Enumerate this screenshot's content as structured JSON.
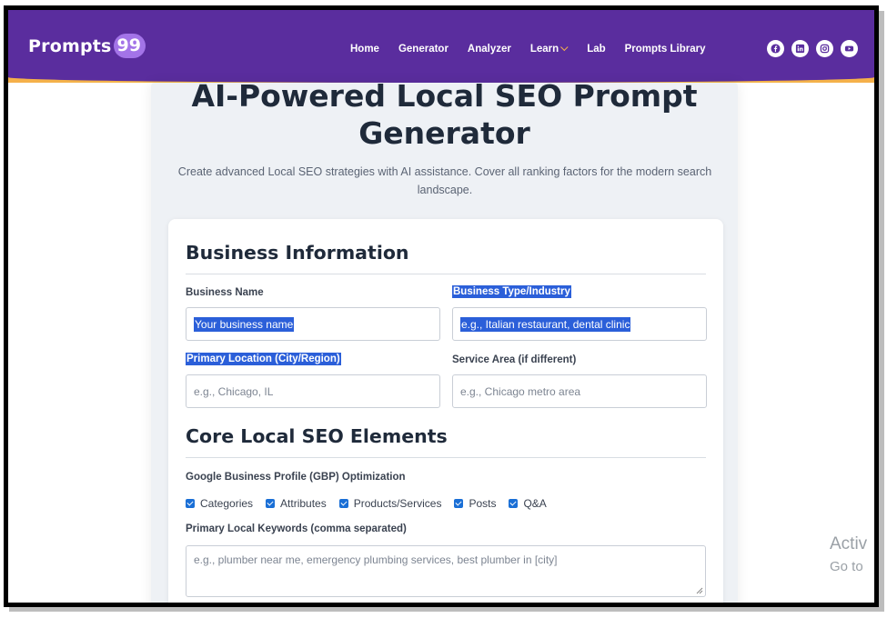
{
  "header": {
    "logo_text": "Prompts",
    "logo_badge": "99",
    "nav": [
      {
        "label": "Home"
      },
      {
        "label": "Generator"
      },
      {
        "label": "Analyzer"
      },
      {
        "label": "Learn"
      },
      {
        "label": "Lab"
      },
      {
        "label": "Prompts Library"
      }
    ],
    "socials": [
      "facebook-icon",
      "linkedin-icon",
      "instagram-icon",
      "youtube-icon"
    ]
  },
  "page": {
    "title_line1": "AI-Powered Local SEO Prompt",
    "title_line2": "Generator",
    "subtitle_line1": "Create advanced Local SEO strategies with AI assistance. Cover all ranking factors for the modern search",
    "subtitle_line2": "landscape."
  },
  "business": {
    "section_title": "Business Information",
    "name_label": "Business Name",
    "name_placeholder": "Your business name",
    "type_label": "Business Type/Industry",
    "type_placeholder": "e.g., Italian restaurant, dental clinic",
    "location_label": "Primary Location (City/Region)",
    "location_placeholder": "e.g., Chicago, IL",
    "service_label": "Service Area (if different)",
    "service_placeholder": "e.g., Chicago metro area"
  },
  "core": {
    "section_title": "Core Local SEO Elements",
    "gbp_label": "Google Business Profile (GBP) Optimization",
    "checks": [
      {
        "label": "Categories"
      },
      {
        "label": "Attributes"
      },
      {
        "label": "Products/Services"
      },
      {
        "label": "Posts"
      },
      {
        "label": "Q&A"
      }
    ],
    "keywords_label": "Primary Local Keywords (comma separated)",
    "keywords_placeholder": "e.g., plumber near me, emergency plumbing services, best plumber in [city]"
  },
  "watermark": {
    "line1": "Activ",
    "line2": "Go to"
  },
  "colors": {
    "nav_bg": "#5a2d9e",
    "accent": "#f5b04a",
    "selection": "#2b5fd9",
    "checkbox": "#1a6fd6"
  }
}
